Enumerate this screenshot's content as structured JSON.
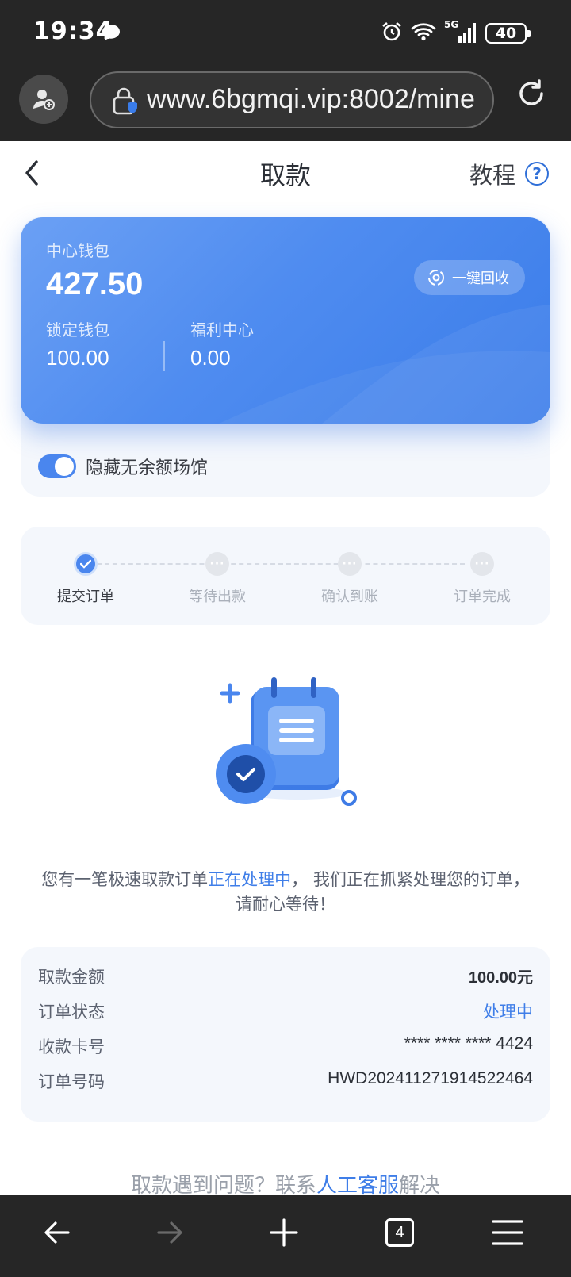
{
  "status_bar": {
    "time": "19:34",
    "network": "5G",
    "battery": "40"
  },
  "browser": {
    "url": "www.6bgmqi.vip:8002/mine"
  },
  "header": {
    "title": "取款",
    "tutorial": "教程",
    "help_symbol": "?"
  },
  "wallet": {
    "center_label": "中心钱包",
    "center_amount": "427.50",
    "recycle_label": "一键回收",
    "locked_label": "锁定钱包",
    "locked_amount": "100.00",
    "welfare_label": "福利中心",
    "welfare_amount": "0.00",
    "hide_toggle_label": "隐藏无余额场馆",
    "hide_toggle_on": true
  },
  "steps": [
    {
      "label": "提交订单",
      "state": "done"
    },
    {
      "label": "等待出款",
      "state": "pending"
    },
    {
      "label": "确认到账",
      "state": "pending"
    },
    {
      "label": "订单完成",
      "state": "pending"
    }
  ],
  "message": {
    "part1": "您有一笔极速取款订单",
    "highlight": "正在处理中",
    "part2": "， 我们正在抓紧处理您的订单，",
    "line2": "请耐心等待！"
  },
  "details": {
    "rows": [
      {
        "label": "取款金额",
        "value": "100.00元"
      },
      {
        "label": "订单状态",
        "value": "处理中"
      },
      {
        "label": "收款卡号",
        "value": "**** **** **** 4424"
      },
      {
        "label": "订单号码",
        "value": "HWD20241127191452246​4"
      }
    ]
  },
  "help": {
    "part1": "取款遇到问题？联系",
    "link": "人工客服",
    "part2": "解决"
  },
  "bottom_nav": {
    "tab_count": "4"
  },
  "colors": {
    "accent": "#3f7ee8",
    "card_start": "#6ba0f4",
    "card_end": "#3a7ce9",
    "panel": "#f4f7fc"
  }
}
